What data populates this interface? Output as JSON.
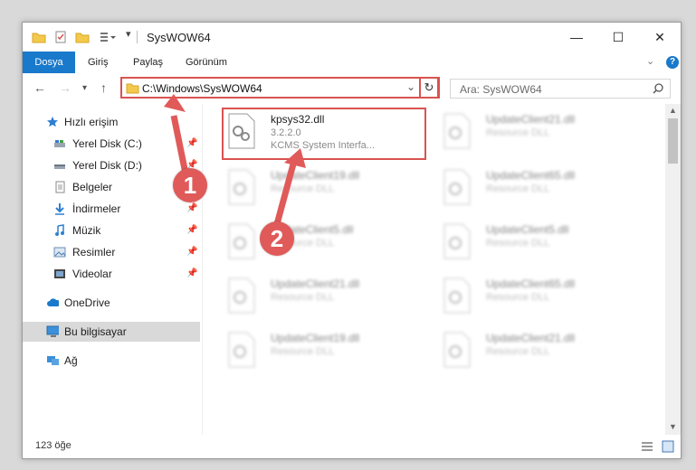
{
  "window": {
    "title": "SysWOW64",
    "controls": {
      "minimize": "—",
      "maximize": "☐",
      "close": "✕"
    }
  },
  "ribbon": {
    "tabs": [
      "Dosya",
      "Giriş",
      "Paylaş",
      "Görünüm"
    ],
    "help": "?"
  },
  "address": {
    "path": "C:\\Windows\\SysWOW64",
    "search_placeholder": "Ara: SysWOW64"
  },
  "sidebar": {
    "items": [
      {
        "label": "Hızlı erişim",
        "icon": "star-icon",
        "pinned": false
      },
      {
        "label": "Yerel Disk (C:)",
        "icon": "drive-icon",
        "pinned": true
      },
      {
        "label": "Yerel Disk (D:)",
        "icon": "drive-icon",
        "pinned": true
      },
      {
        "label": "Belgeler",
        "icon": "documents-icon",
        "pinned": true
      },
      {
        "label": "İndirmeler",
        "icon": "download-icon",
        "pinned": true
      },
      {
        "label": "Müzik",
        "icon": "music-icon",
        "pinned": true
      },
      {
        "label": "Resimler",
        "icon": "pictures-icon",
        "pinned": true
      },
      {
        "label": "Videolar",
        "icon": "video-icon",
        "pinned": true
      },
      {
        "label": "OneDrive",
        "icon": "cloud-icon",
        "pinned": false
      },
      {
        "label": "Bu bilgisayar",
        "icon": "computer-icon",
        "pinned": false
      },
      {
        "label": "Ağ",
        "icon": "network-icon",
        "pinned": false
      }
    ]
  },
  "files": [
    {
      "name": "kpsys32.dll",
      "detail": "3.2.2.0",
      "type": "KCMS System Interfa..."
    },
    {
      "name": "UpdateClient21.dll",
      "type": "Resource DLL"
    },
    {
      "name": "UpdateClient19.dll",
      "type": "Resource DLL"
    },
    {
      "name": "UpdateClient65.dll",
      "type": "Resource DLL"
    },
    {
      "name": "UpdateClient5.dll",
      "type": "Resource DLL"
    },
    {
      "name": "UpdateClient5.dll",
      "type": "Resource DLL"
    },
    {
      "name": "UpdateClient21.dll",
      "type": "Resource DLL"
    },
    {
      "name": "UpdateClient65.dll",
      "type": "Resource DLL"
    },
    {
      "name": "UpdateClient19.dll",
      "type": "Resource DLL"
    },
    {
      "name": "UpdateClient21.dll",
      "type": "Resource DLL"
    }
  ],
  "status": {
    "count": "123 öğe"
  },
  "callouts": {
    "one": "1",
    "two": "2"
  },
  "colors": {
    "accent": "#1979ca",
    "highlight": "#d9534f",
    "callout": "#e05a5a"
  }
}
